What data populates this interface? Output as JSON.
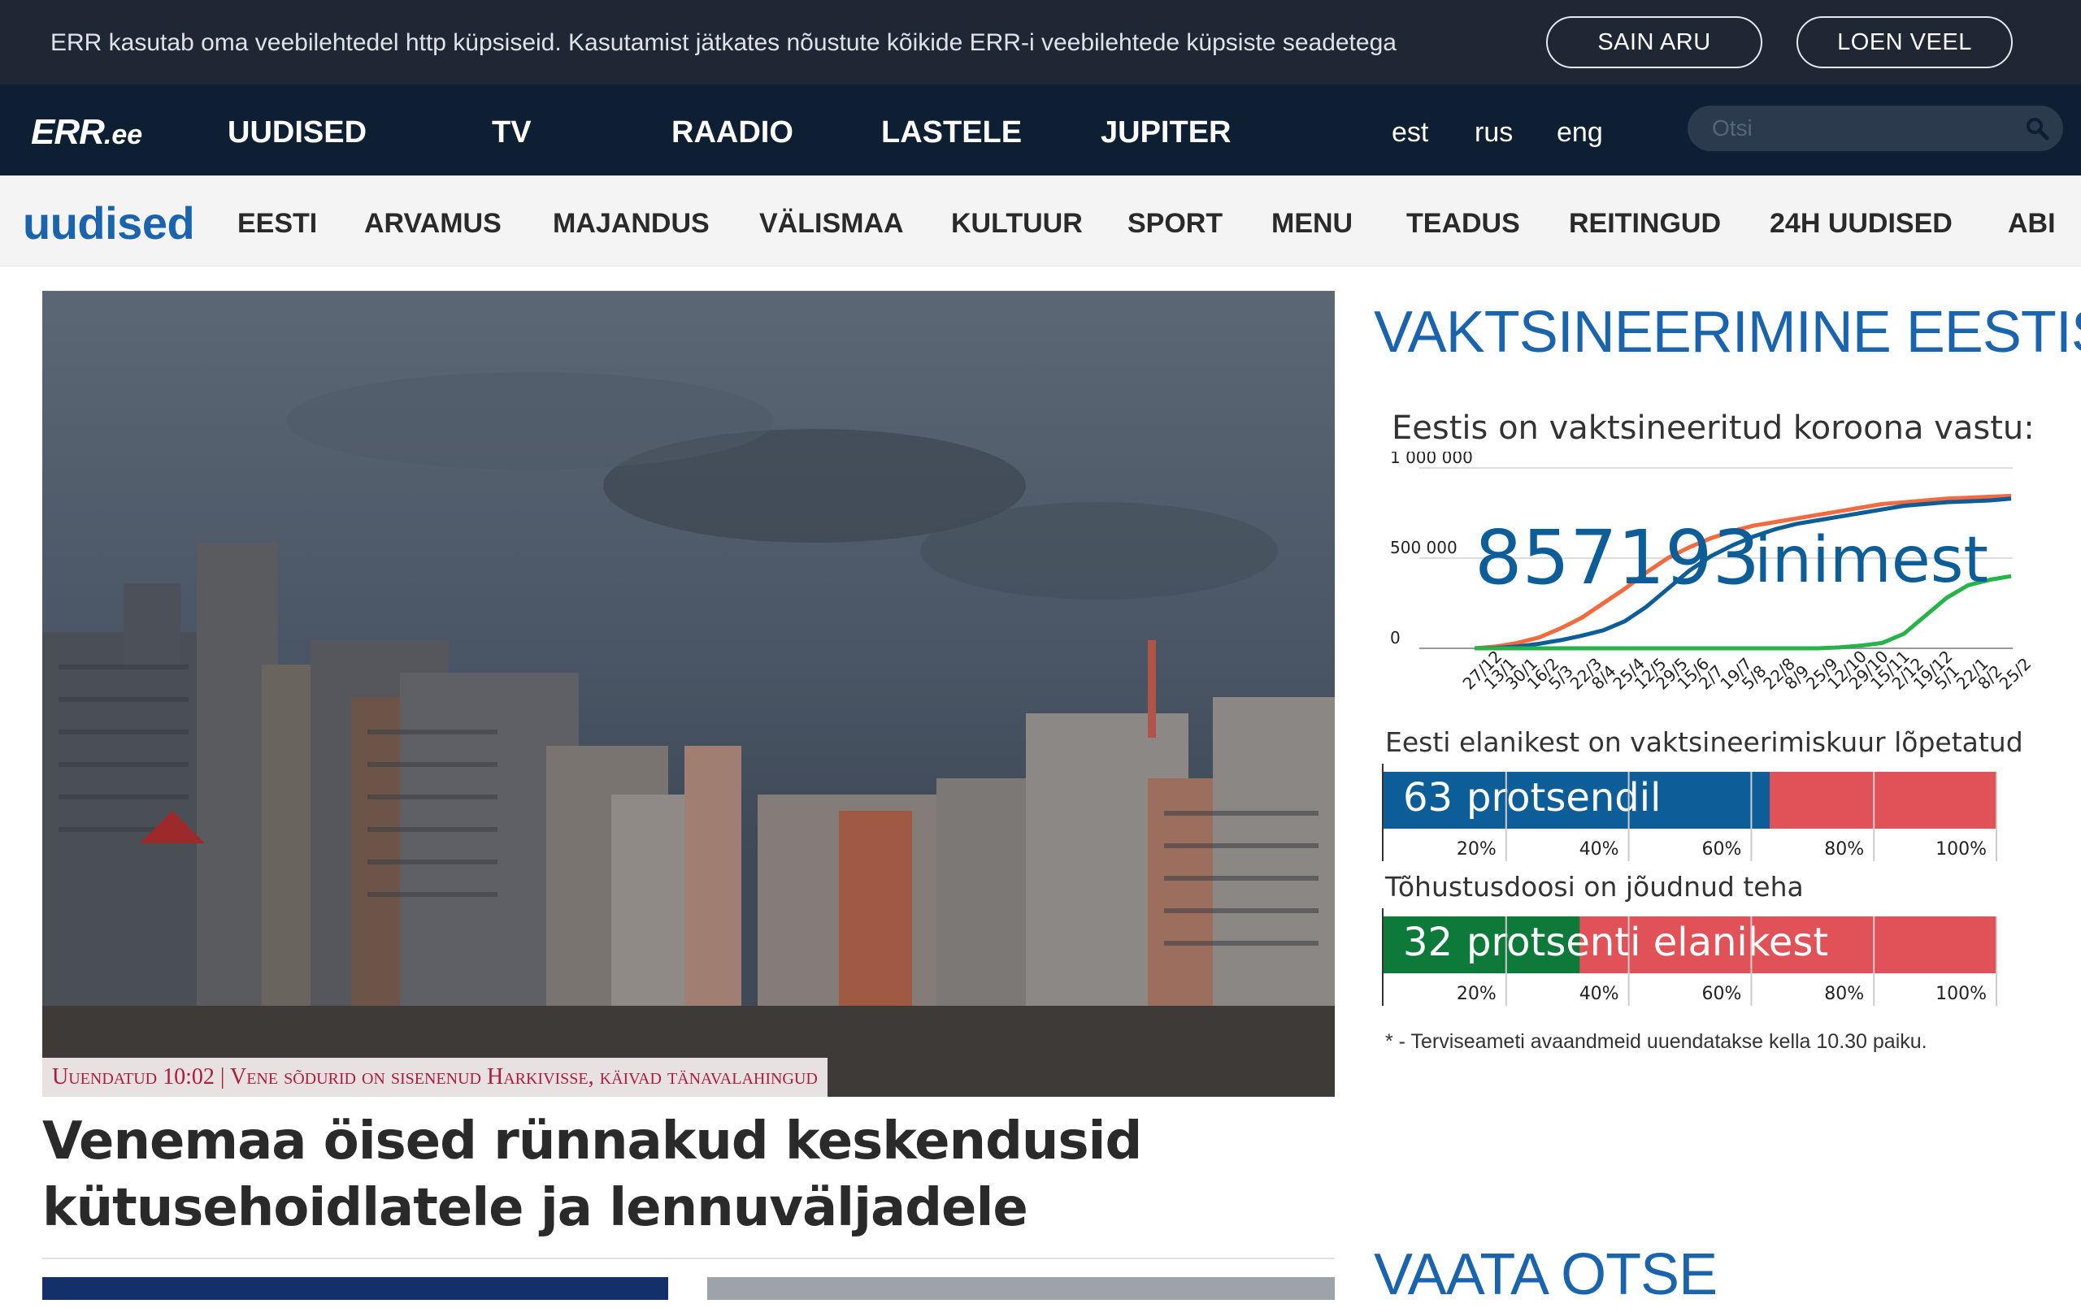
{
  "cookie": {
    "text": "ERR kasutab oma veebilehtedel http küpsiseid. Kasutamist jätkates nõustute kõikide ERR-i veebilehtede küpsiste seadetega",
    "accept_label": "SAIN ARU",
    "more_label": "LOEN VEEL"
  },
  "topnav": {
    "logo_main": "ERR",
    "logo_suffix": ".ee",
    "items": [
      "UUDISED",
      "TV",
      "RAADIO",
      "LASTELE",
      "JUPITER"
    ],
    "langs": [
      "est",
      "rus",
      "eng"
    ],
    "search_placeholder": "Otsi",
    "search_icon": "search-icon"
  },
  "subnav": {
    "section": "uudised",
    "items": [
      "EESTI",
      "ARVAMUS",
      "MAJANDUS",
      "VÄLISMAA",
      "KULTUUR",
      "SPORT",
      "MENU",
      "TEADUS",
      "REITINGUD",
      "24H UUDISED",
      "ABI"
    ]
  },
  "hero": {
    "caption": "Uuendatud 10:02 | Vene sõdurid on sisenenud Harkivisse, käivad tänavalahingud",
    "headline": "Venemaa öised rünnakud keskendusid kütusehoidlatele ja lennuväljadele"
  },
  "vaccination": {
    "title": "VAKTSINEERIMINE EESTIS",
    "subtitle": "Eestis on vaktsineeritud koroona vastu:",
    "total_number": "857193",
    "total_unit": "inimest",
    "bar1_title": "Eesti elanikest on vaktsineerimiskuur lõpetatud",
    "bar1_value": "63",
    "bar1_label": "protsendil",
    "bar1_pct": 63,
    "bar2_title": "Tõhustusdoosi on jõudnud teha",
    "bar2_value": "32",
    "bar2_label": "protsenti elanikest",
    "bar2_pct": 32,
    "bar_ticks": [
      "20%",
      "40%",
      "60%",
      "80%",
      "100%"
    ],
    "note": "* - Terviseameti avaandmeid uuendatakse kella 10.30 paiku.",
    "colors": {
      "blue": "#0d5d99",
      "red": "#e05258",
      "green": "#0e7a3a",
      "orange": "#f26a3d",
      "line_green": "#25b34a"
    }
  },
  "live": {
    "title": "VAATA OTSE"
  },
  "chart_data": {
    "type": "line",
    "title": "Eestis on vaktsineeritud koroona vastu:",
    "ylim": [
      0,
      1000000
    ],
    "yticks": [
      "0",
      "500 000",
      "1 000 000"
    ],
    "x": [
      "27/12",
      "13/1",
      "30/1",
      "16/2",
      "5/3",
      "22/3",
      "8/4",
      "25/4",
      "12/5",
      "29/5",
      "15/6",
      "2/7",
      "19/7",
      "5/8",
      "22/8",
      "8/9",
      "25/9",
      "12/10",
      "29/10",
      "15/11",
      "2/12",
      "19/12",
      "5/1",
      "22/1",
      "8/2",
      "25/2"
    ],
    "series": [
      {
        "color": "#f26a3d",
        "values": [
          0,
          10000,
          30000,
          60000,
          110000,
          170000,
          250000,
          330000,
          420000,
          500000,
          560000,
          610000,
          650000,
          680000,
          700000,
          720000,
          740000,
          760000,
          780000,
          800000,
          810000,
          820000,
          830000,
          835000,
          840000,
          845000
        ]
      },
      {
        "color": "#0d5d99",
        "values": [
          0,
          2000,
          10000,
          25000,
          45000,
          70000,
          100000,
          150000,
          230000,
          330000,
          430000,
          510000,
          570000,
          620000,
          660000,
          690000,
          710000,
          730000,
          750000,
          770000,
          790000,
          800000,
          810000,
          815000,
          820000,
          830000
        ]
      },
      {
        "color": "#25b34a",
        "values": [
          0,
          0,
          0,
          0,
          0,
          0,
          0,
          0,
          0,
          0,
          0,
          0,
          0,
          0,
          0,
          0,
          0,
          5000,
          15000,
          30000,
          80000,
          180000,
          280000,
          350000,
          380000,
          400000
        ]
      }
    ]
  }
}
